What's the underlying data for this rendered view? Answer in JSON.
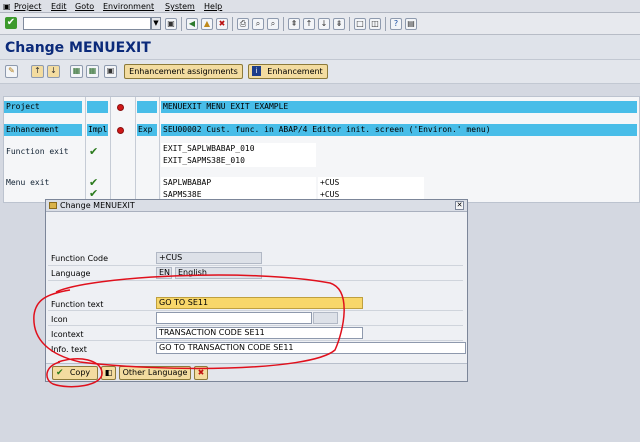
{
  "menubar": {
    "items": [
      "Project",
      "Edit",
      "Goto",
      "Environment",
      "System",
      "Help"
    ]
  },
  "page": {
    "title": "Change MENUEXIT"
  },
  "apptoolbar": {
    "enh_assign": "Enhancement assignments",
    "enhancement": "Enhancement"
  },
  "grid": {
    "project_label": "Project",
    "project_text": "MENUEXIT MENU EXIT EXAMPLE",
    "enh_label": "Enhancement",
    "enh_col1": "Impl",
    "enh_col3": "Exp",
    "enh_text": "SEU00002 Cust. func. in ABAP/4 Editor init. screen ('Environ.' menu)",
    "func_label": "Function exit",
    "func_exits": [
      "EXIT_SAPLWBABAP_010",
      "EXIT_SAPMS38E_010"
    ],
    "menu_label": "Menu exit",
    "menu_exits": [
      {
        "program": "SAPLWBABAP",
        "code": "+CUS"
      },
      {
        "program": "SAPMS38E",
        "code": "+CUS"
      }
    ]
  },
  "dialog": {
    "title": "Change MENUEXIT",
    "fields": {
      "function_code": {
        "label": "Function Code",
        "value": "+CUS"
      },
      "language": {
        "label": "Language",
        "code": "EN",
        "name": "English"
      },
      "function_text": {
        "label": "Function text",
        "value": "GO TO SE11"
      },
      "icon": {
        "label": "Icon",
        "value": ""
      },
      "icontext": {
        "label": "Icontext",
        "value": "TRANSACTION CODE SE11"
      },
      "info_text": {
        "label": "Info. text",
        "value": "GO TO TRANSACTION CODE SE11"
      }
    },
    "buttons": {
      "copy": "Copy",
      "other_language": "Other Language"
    }
  },
  "colors": {
    "title": "#0b2a7a",
    "highlight": "#48bde8",
    "annotation": "#e0101c",
    "button": "#f3dca0"
  }
}
